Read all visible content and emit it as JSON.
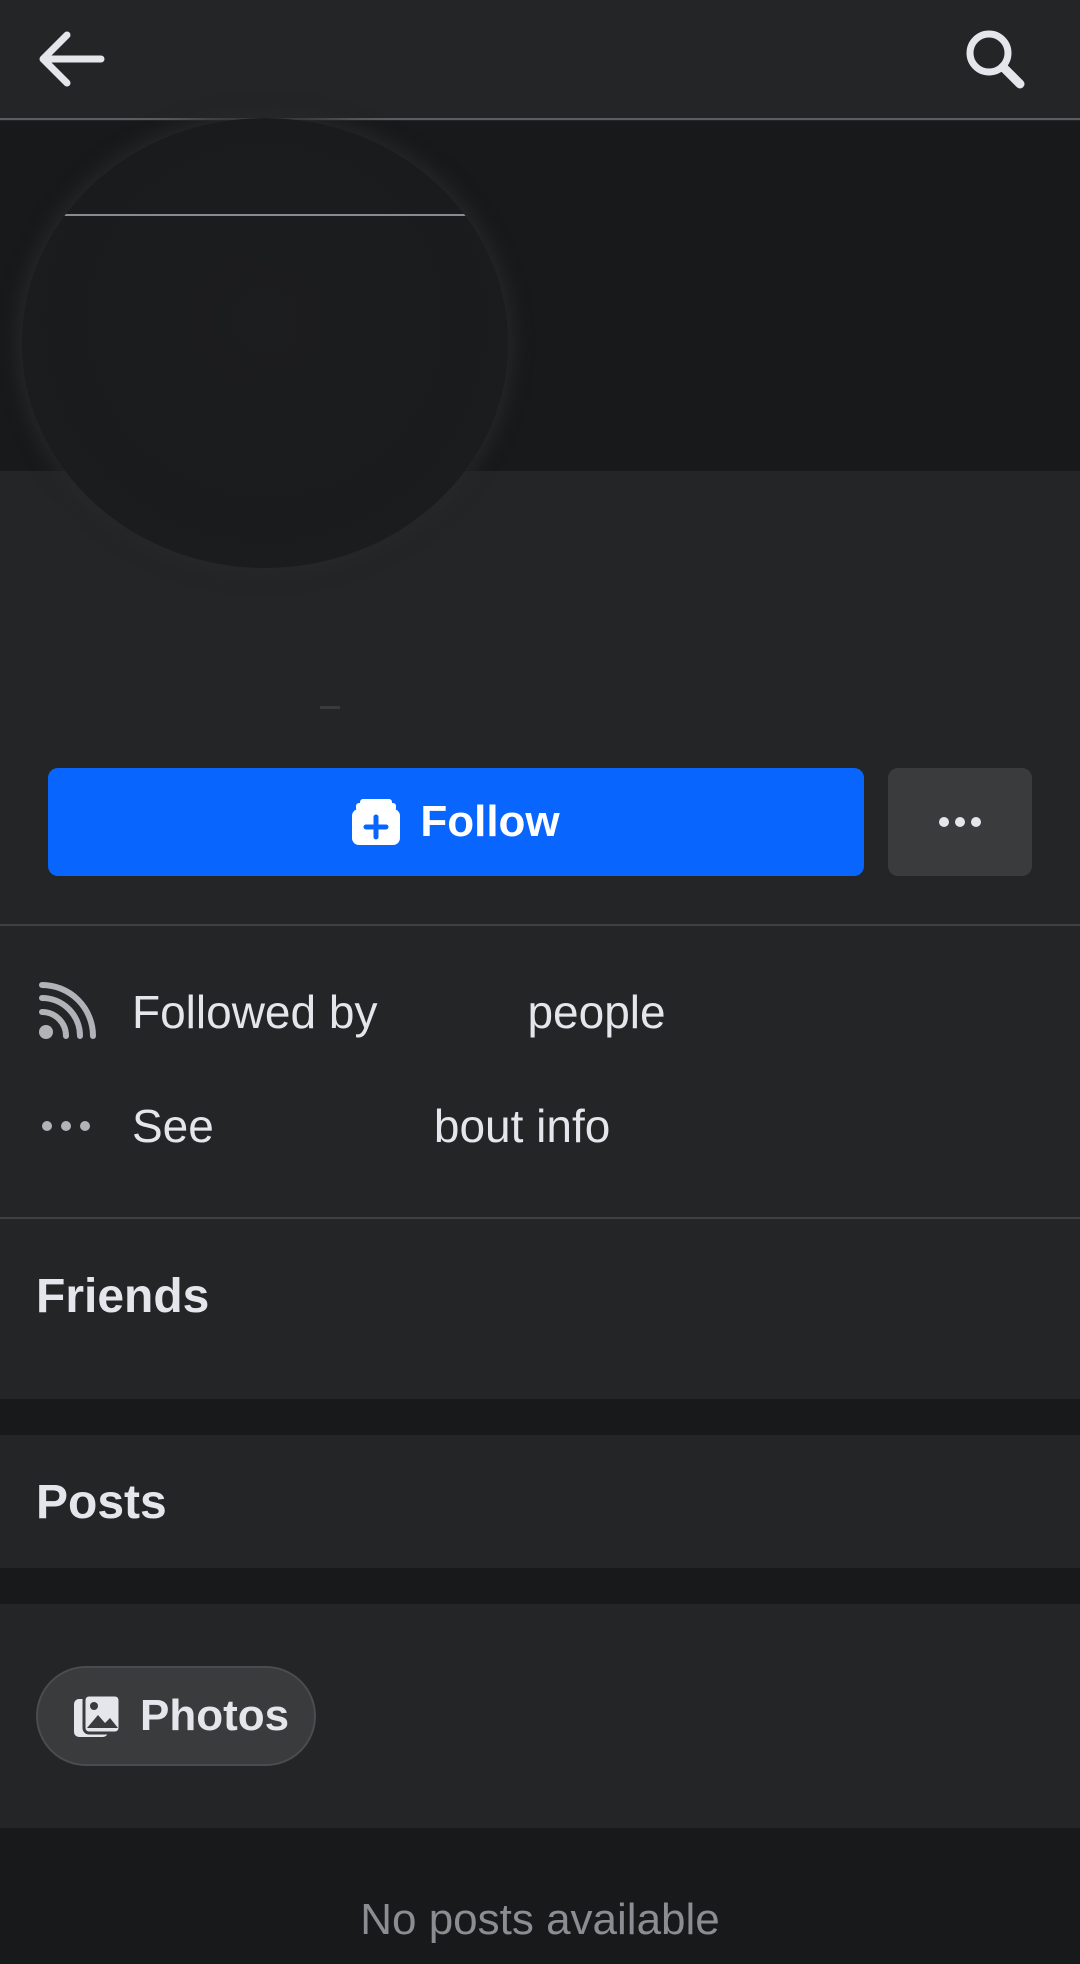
{
  "header": {
    "back_icon": "arrow-left-icon",
    "search_icon": "search-icon"
  },
  "profile": {
    "follow_label": "Follow",
    "more_icon": "more-horizontal-icon"
  },
  "info": {
    "followers_text": "Followed by",
    "followers_suffix": "people",
    "about_prefix": "See",
    "about_suffix": "bout info"
  },
  "sections": {
    "friends_title": "Friends",
    "posts_title": "Posts",
    "photos_label": "Photos",
    "empty_message": "No posts available"
  },
  "colors": {
    "accent": "#0866ff",
    "background": "#242526",
    "dark_background": "#18191a",
    "text": "#e4e6eb",
    "muted_text": "#8a8d91"
  }
}
